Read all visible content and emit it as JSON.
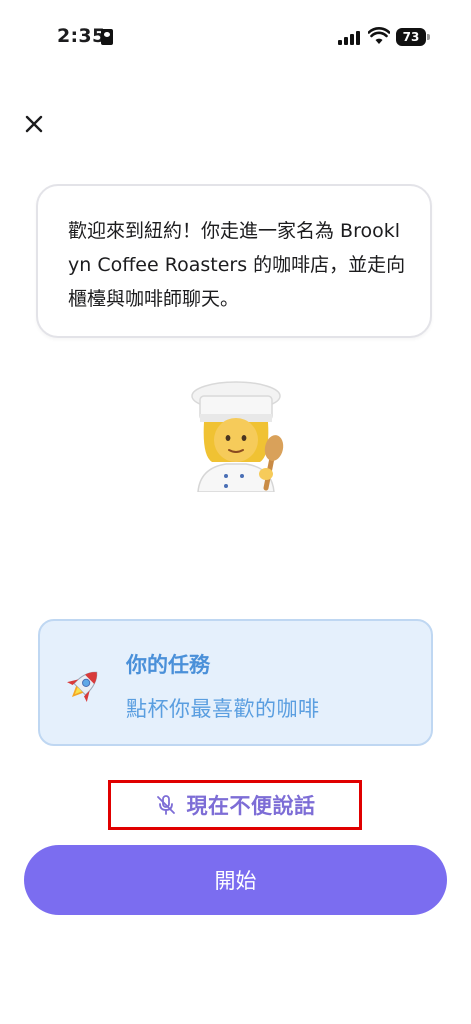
{
  "status_bar": {
    "time": "2:35",
    "battery_level": "73"
  },
  "bubble": {
    "text": "歡迎來到紐約！你走進一家名為 Brooklyn Coffee Roasters 的咖啡店，並走向櫃檯與咖啡師聊天。"
  },
  "mission": {
    "title": "你的任務",
    "description": "點杯你最喜歡的咖啡"
  },
  "actions": {
    "cant_talk_label": "現在不便說話",
    "start_label": "開始"
  },
  "colors": {
    "accent": "#7b6df0",
    "mission_bg": "#e5f0fc",
    "mission_text": "#4a90d9",
    "highlight": "#e00000"
  },
  "icons": [
    "id-card-icon",
    "signal-icon",
    "wifi-icon",
    "battery-icon",
    "close-icon",
    "chef-avatar",
    "rocket-icon",
    "mic-off-icon"
  ]
}
